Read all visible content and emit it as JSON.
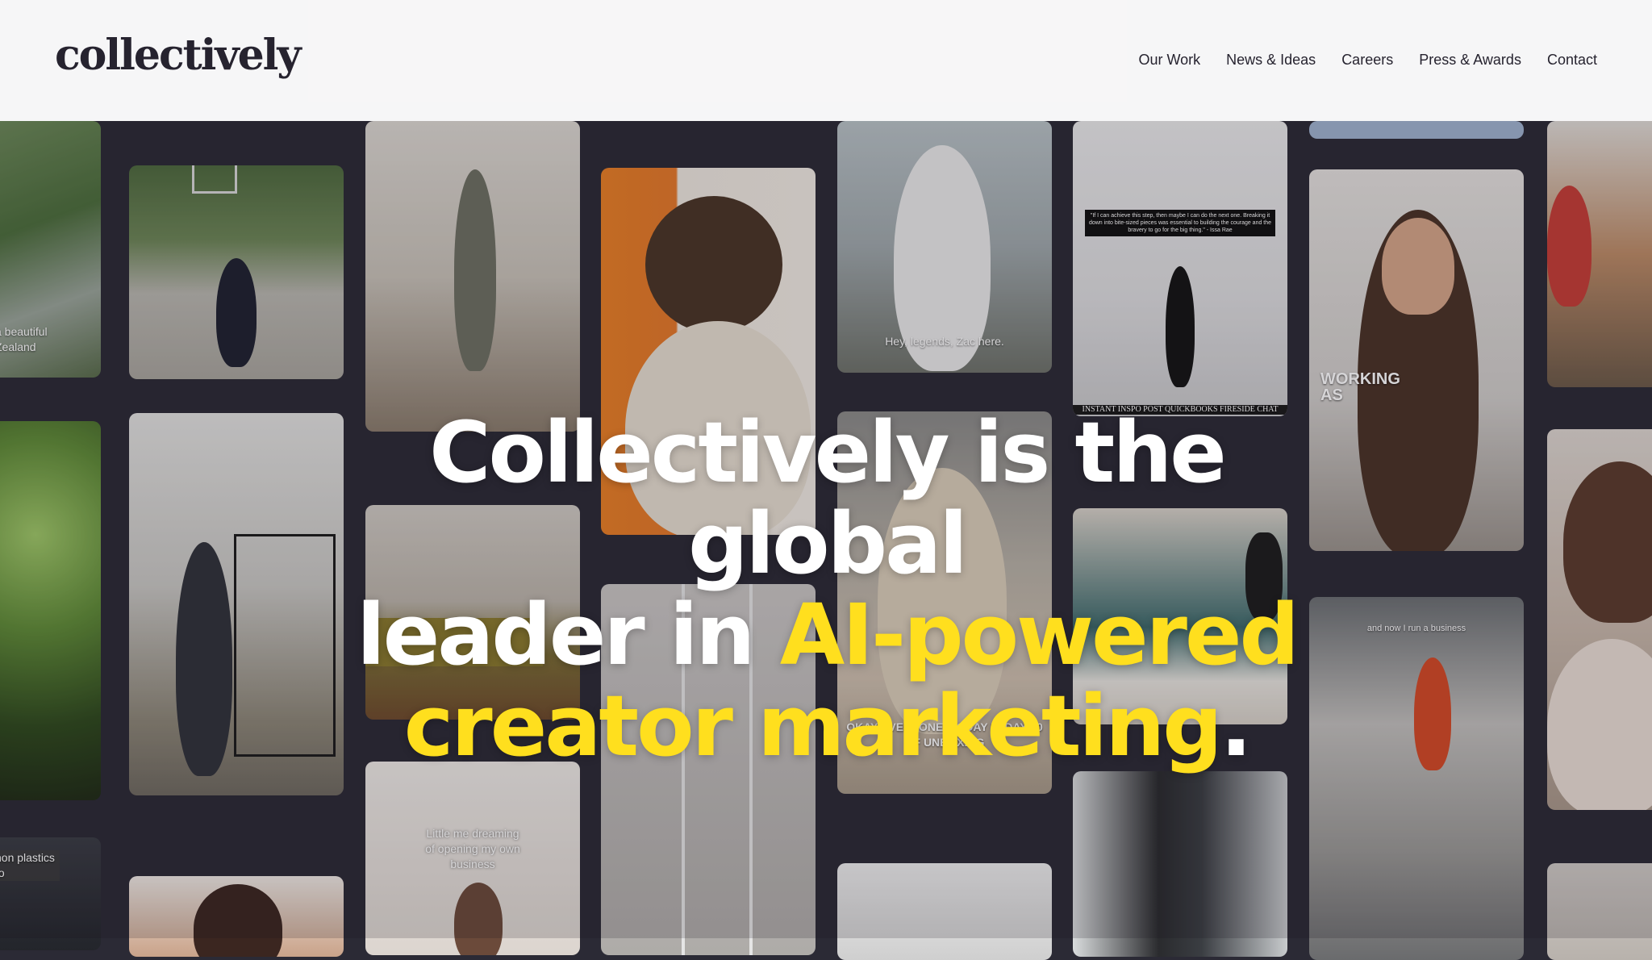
{
  "header": {
    "logo": "collectively",
    "nav": [
      "Our Work",
      "News & Ideas",
      "Careers",
      "Press & Awards",
      "Contact"
    ]
  },
  "hero": {
    "line1": "Collectively is the global",
    "line2_white": "leader in ",
    "line2_yellow": "AI-powered",
    "line3_yellow": "creator marketing",
    "line3_end": ".",
    "accent_color": "#ffdf1e"
  },
  "tiles": {
    "t_newzealand": "a beautiful\nZealand",
    "t_plastics": "non plastics to",
    "t_zac": "Hey, legends, Zac here.",
    "t_quote": "\"If I can achieve this step, then maybe I can do the next one. Breaking it down into bite-sized pieces was essential to building the courage and the bravery to go for the big thing.\" - Issa Rae",
    "t_fireside": "INSTANT INSPO POST QUICKBOOKS FIRESIDE CHAT",
    "t_working": "WORKING\nAS",
    "t_unboxing": "OKAY EVERYONE, TODAY IS DAY 10\nOF UNBOXING",
    "t_business": "and now I run a business",
    "t_dreaming": "Little me dreaming\nof opening my own\nbusiness"
  }
}
